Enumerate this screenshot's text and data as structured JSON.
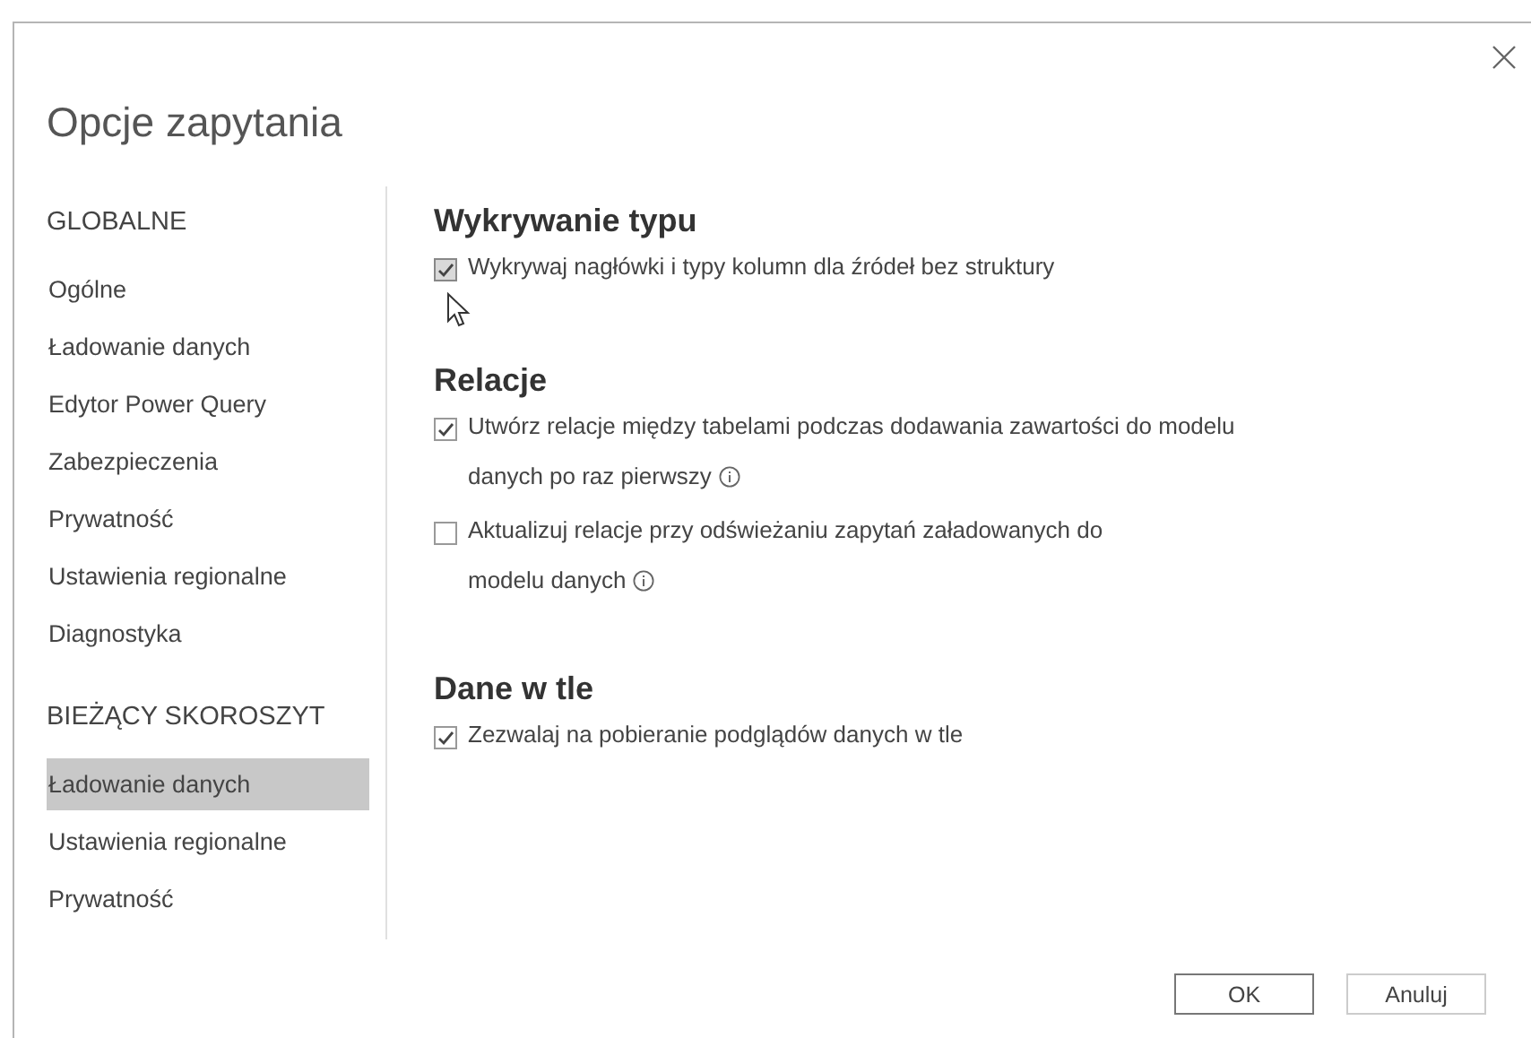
{
  "dialog": {
    "title": "Opcje zapytania"
  },
  "sidebar": {
    "sections": [
      {
        "heading": "GLOBALNE",
        "items": [
          {
            "label": "Ogólne",
            "selected": false
          },
          {
            "label": "Ładowanie danych",
            "selected": false
          },
          {
            "label": "Edytor Power Query",
            "selected": false
          },
          {
            "label": "Zabezpieczenia",
            "selected": false
          },
          {
            "label": "Prywatność",
            "selected": false
          },
          {
            "label": "Ustawienia regionalne",
            "selected": false
          },
          {
            "label": "Diagnostyka",
            "selected": false
          }
        ]
      },
      {
        "heading": "BIEŻĄCY SKOROSZYT",
        "items": [
          {
            "label": "Ładowanie danych",
            "selected": true
          },
          {
            "label": "Ustawienia regionalne",
            "selected": false
          },
          {
            "label": "Prywatność",
            "selected": false
          }
        ]
      }
    ]
  },
  "content": {
    "sections": [
      {
        "heading": "Wykrywanie typu",
        "options": [
          {
            "label": "Wykrywaj nagłówki i typy kolumn dla źródeł bez struktury",
            "checked": true,
            "hovered": true,
            "info": false
          }
        ]
      },
      {
        "heading": "Relacje",
        "options": [
          {
            "label": "Utwórz relacje między tabelami podczas dodawania zawartości do modelu\ndanych po raz pierwszy",
            "checked": true,
            "hovered": false,
            "info": true
          },
          {
            "label": "Aktualizuj relacje przy odświeżaniu zapytań załadowanych do\nmodelu danych",
            "checked": false,
            "hovered": false,
            "info": true
          }
        ]
      },
      {
        "heading": "Dane w tle",
        "options": [
          {
            "label": "Zezwalaj na pobieranie podglądów danych w tle",
            "checked": true,
            "hovered": false,
            "info": false
          }
        ]
      }
    ]
  },
  "buttons": [
    {
      "label": "OK",
      "kind": "primary"
    },
    {
      "label": "Anuluj",
      "kind": "secondary"
    }
  ]
}
